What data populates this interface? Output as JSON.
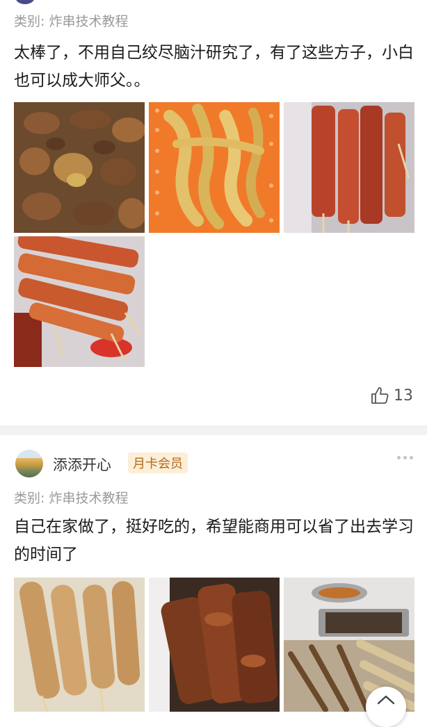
{
  "feed": {
    "posts": [
      {
        "category_label": "类别:",
        "category_value": "炸串技术教程",
        "text": "太棒了，不用自己绞尽脑汁研究了，有了这些方子，小白也可以成大师父。。",
        "images": [
          {
            "icon": "braised-chicken-gizzards-image"
          },
          {
            "icon": "fried-crispy-strips-image"
          },
          {
            "icon": "marinated-meat-skewers-image"
          },
          {
            "icon": "spiced-meat-skewers-image"
          }
        ],
        "like_count": "13"
      },
      {
        "username": "添添开心",
        "badge": "月卡会员",
        "category_label": "类别:",
        "category_value": "炸串技术教程",
        "text": "自己在家做了，挺好吃的，希望能商用可以省了出去学习的时间了",
        "images": [
          {
            "icon": "fried-sausage-skewers-image"
          },
          {
            "icon": "fried-chicken-skewers-image"
          },
          {
            "icon": "skewers-on-tray-image"
          }
        ]
      }
    ]
  },
  "colors": {
    "text_primary": "#1a1a1a",
    "text_secondary": "#9a9a9a",
    "badge_bg": "#fdeed8",
    "badge_text": "#b06a1a",
    "divider": "#f2f2f2"
  }
}
